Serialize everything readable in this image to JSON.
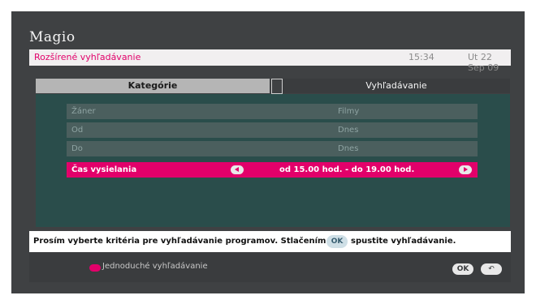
{
  "logo": {
    "brand": "Magio"
  },
  "header": {
    "title": "Rozšírené vyhľadávanie",
    "time": "15:34",
    "date": "Ut 22 Sep 09"
  },
  "tabs": [
    {
      "label": "Kategórie"
    },
    {
      "label": "Vyhľadávanie"
    }
  ],
  "criteria": [
    {
      "label": "Žáner",
      "value": "Filmy"
    },
    {
      "label": "Od",
      "value": "Dnes"
    },
    {
      "label": "Do",
      "value": "Dnes"
    },
    {
      "label": "Čas vysielania",
      "value": "od 15.00 hod. - do 19.00 hod."
    }
  ],
  "info": {
    "text_before": "Prosím vyberte kritéria pre vyhľadávanie programov. Stlačením",
    "ok_label": "OK",
    "text_after": "spustite vyhľadávanie."
  },
  "footer": {
    "red_button_label": "Jednoduché vyhľadávanie",
    "ok_label": "OK",
    "back_glyph": "↶"
  },
  "colors": {
    "accent": "#e2006a",
    "panel": "#2a4d4b",
    "row": "#4b5f5e"
  }
}
